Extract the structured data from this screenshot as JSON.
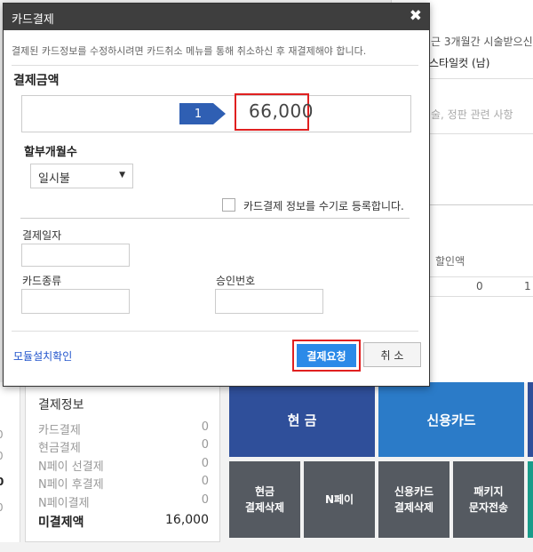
{
  "background": {
    "top_right_partial_1": "근 3개월간 시술받으신",
    "top_right_partial_2": "스타일컷 (남)",
    "top_right_partial_3": "술, 정판 관련 사항",
    "discount_label": "할인액",
    "discount_value": "0",
    "discount_value_2": "1",
    "left_edge_digits": [
      "0",
      "0",
      "0",
      "0"
    ]
  },
  "payment_info": {
    "title": "결제정보",
    "rows": [
      {
        "label": "카드결제",
        "value": "0"
      },
      {
        "label": "현금결제",
        "value": "0"
      },
      {
        "label": "N페이 선결제",
        "value": "0"
      },
      {
        "label": "N페이 후결제",
        "value": "0"
      },
      {
        "label": "N페이결제",
        "value": "0"
      }
    ],
    "unpaid_label": "미결제액",
    "unpaid_value": "16,000"
  },
  "tiles": {
    "cash": "현 금",
    "credit_card": "신용카드",
    "cash_delete": [
      "현금",
      "결제삭제"
    ],
    "npay": "N페이",
    "card_delete": [
      "신용카드",
      "결제삭제"
    ],
    "package_sms": [
      "패키지",
      "문자전송"
    ]
  },
  "modal": {
    "title": "카드결제",
    "close": "✖",
    "notice": "결제된 카드정보를 수정하시려면 카드취소 메뉴를 통해 취소하신 후 재결제해야 합니다.",
    "amount_label": "결제금액",
    "step_number": "1",
    "amount_value": "66,000",
    "installment_label": "할부개월수",
    "installment_value": "일시불",
    "manual_register_label": "카드결제 정보를 수기로 등록합니다.",
    "payment_date_label": "결제일자",
    "card_type_label": "카드종류",
    "approval_no_label": "승인번호",
    "module_check_link": "모듈설치확인",
    "request_button": "결제요청",
    "cancel_button": "취 소"
  },
  "colors": {
    "header": "#3e3e3e",
    "highlight": "#e02020",
    "primary_button": "#2b8ae8",
    "badge": "#2f5fb3"
  }
}
